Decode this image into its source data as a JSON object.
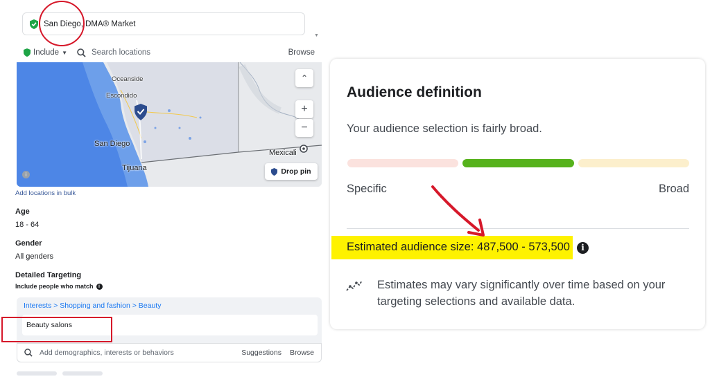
{
  "location": {
    "selected": "San Diego, DMA® Market",
    "include_label": "Include",
    "search_placeholder": "Search locations",
    "browse_label": "Browse",
    "add_bulk_label": "Add locations in bulk",
    "drop_pin_label": "Drop pin",
    "map_labels": {
      "oceanside": "Oceanside",
      "escondido": "Escondido",
      "san_diego": "San Diego",
      "tijuana": "Tijuana",
      "mexicali": "Mexicali"
    },
    "zoom_in": "+",
    "zoom_out": "−",
    "collapse": "⌃"
  },
  "age": {
    "title": "Age",
    "value": "18 - 64"
  },
  "gender": {
    "title": "Gender",
    "value": "All genders"
  },
  "detailed_targeting": {
    "title": "Detailed Targeting",
    "subtitle": "Include people who match",
    "breadcrumb": "Interests > Shopping and fashion > Beauty",
    "interest": "Beauty salons",
    "add_placeholder": "Add demographics, interests or behaviors",
    "suggestions_label": "Suggestions",
    "browse_label": "Browse"
  },
  "audience": {
    "title": "Audience definition",
    "subtitle": "Your audience selection is fairly broad.",
    "specific_label": "Specific",
    "broad_label": "Broad",
    "estimated": "Estimated audience size: 487,500 - 573,500",
    "note": "Estimates may vary significantly over time based on your targeting selections and available data.",
    "gauge_segment_active": "middle"
  },
  "colors": {
    "accent": "#1877f2",
    "gauge_specific": "#fbe2de",
    "gauge_active": "#56b21c",
    "gauge_broad": "#fcefcc",
    "highlight": "#fef200",
    "annotation": "#d6182a",
    "pin_green": "#1ea446"
  },
  "icons": {
    "location_check": "shield-check-icon",
    "search": "search-icon",
    "info": "info-icon",
    "trend": "trend-line-icon",
    "pin": "map-pin-icon"
  }
}
